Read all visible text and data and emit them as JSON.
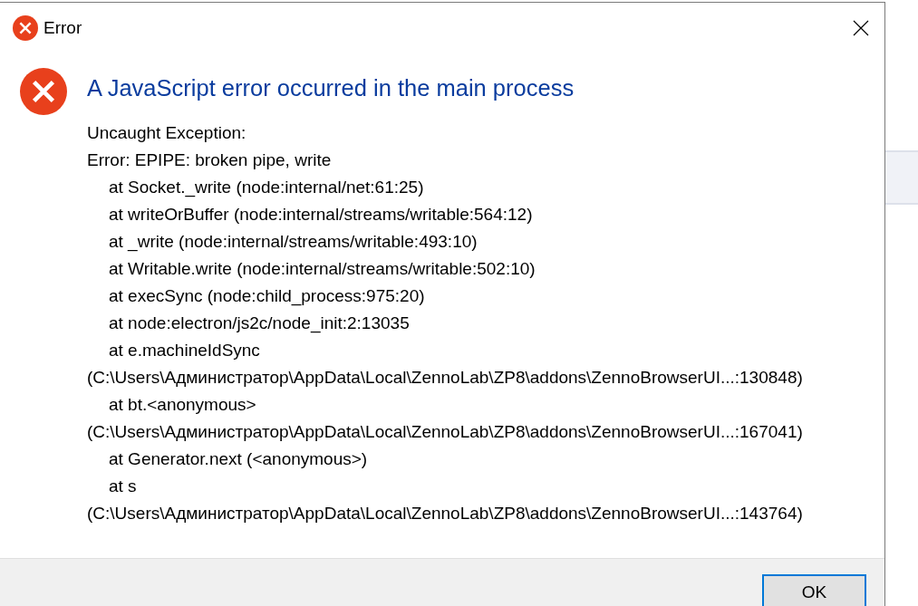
{
  "window": {
    "title": "Error"
  },
  "heading": "A JavaScript error occurred in the main process",
  "message_lines": [
    {
      "text": "Uncaught Exception:",
      "indented": false
    },
    {
      "text": "Error: EPIPE: broken pipe, write",
      "indented": false
    },
    {
      "text": "at Socket._write (node:internal/net:61:25)",
      "indented": true
    },
    {
      "text": "at writeOrBuffer (node:internal/streams/writable:564:12)",
      "indented": true
    },
    {
      "text": "at _write (node:internal/streams/writable:493:10)",
      "indented": true
    },
    {
      "text": "at Writable.write (node:internal/streams/writable:502:10)",
      "indented": true
    },
    {
      "text": "at execSync (node:child_process:975:20)",
      "indented": true
    },
    {
      "text": "at node:electron/js2c/node_init:2:13035",
      "indented": true
    },
    {
      "text": "at e.machineIdSync",
      "indented": true
    },
    {
      "text": "(C:\\Users\\Администратор\\AppData\\Local\\ZennoLab\\ZP8\\addons\\ZennoBrowserUI...:130848)",
      "indented": false
    },
    {
      "text": "at bt.<anonymous>",
      "indented": true
    },
    {
      "text": "(C:\\Users\\Администратор\\AppData\\Local\\ZennoLab\\ZP8\\addons\\ZennoBrowserUI...:167041)",
      "indented": false
    },
    {
      "text": "at Generator.next (<anonymous>)",
      "indented": true
    },
    {
      "text": "at s",
      "indented": true
    },
    {
      "text": "(C:\\Users\\Администратор\\AppData\\Local\\ZennoLab\\ZP8\\addons\\ZennoBrowserUI...:143764)",
      "indented": false
    }
  ],
  "buttons": [
    {
      "label": "OK",
      "selected": true
    }
  ]
}
